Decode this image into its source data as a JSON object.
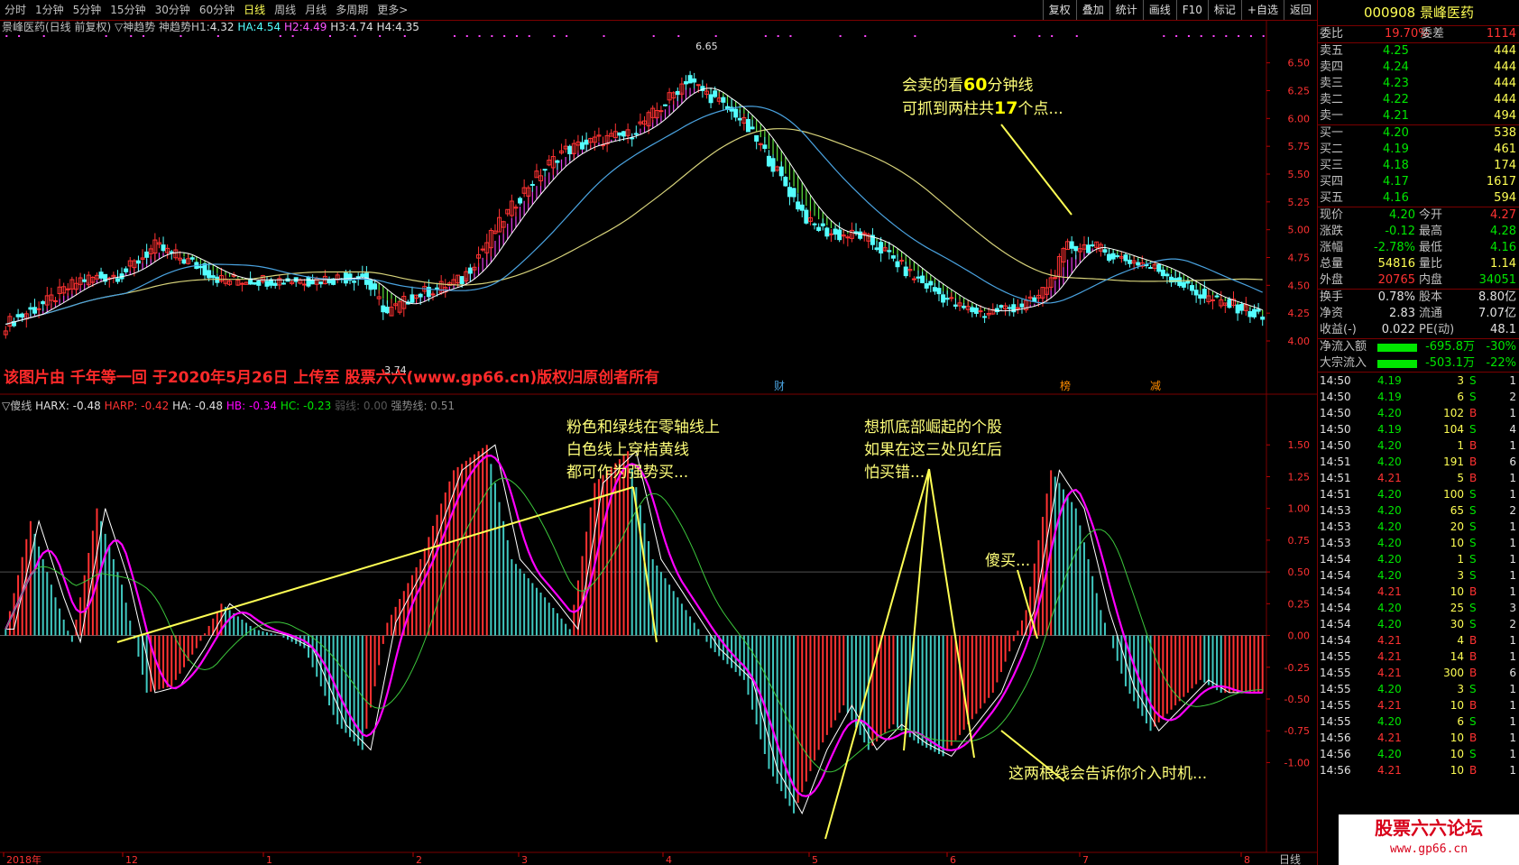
{
  "toolbar": {
    "tabs": [
      "分时",
      "1分钟",
      "5分钟",
      "15分钟",
      "30分钟",
      "60分钟",
      "日线",
      "周线",
      "月线",
      "多周期",
      "更多>"
    ],
    "active_tab": "日线",
    "right_buttons": [
      "复权",
      "叠加",
      "统计",
      "画线",
      "F10",
      "标记",
      "+自选",
      "返回"
    ]
  },
  "chart_header": {
    "stock": "景峰医药(日线 前复权)",
    "indicator": "▽神趋势  神趋势H1:",
    "h1": "4.32",
    "ha_label": "HA:",
    "ha": "4.54",
    "h2_label": "H2:",
    "h2": "4.49",
    "h3_label": "H3:",
    "h3": "4.74",
    "h4_label": "H4:",
    "h4": "4.35"
  },
  "price_axis": [
    "6.50",
    "6.25",
    "6.00",
    "5.75",
    "5.50",
    "5.25",
    "5.00",
    "4.75",
    "4.50",
    "4.25",
    "4.00"
  ],
  "price_annotations": {
    "high": "6.65",
    "low": "3.74"
  },
  "watermark": "该图片由  千年等一回  于2020年5月26日  上传至  股票六六(www.gp66.cn)版权归原创者所有",
  "event_marks": [
    "财",
    "榜",
    "减"
  ],
  "osc_header": {
    "name": "▽傻线",
    "harx": "HARX: -0.48",
    "harp": "HARP: -0.42",
    "ha": "HA: -0.48",
    "hb": "HB: -0.34",
    "hc": "HC: -0.23",
    "hd": "弱线: 0.00",
    "strong": "强势线: 0.51"
  },
  "osc_axis": [
    "1.50",
    "1.25",
    "1.00",
    "0.75",
    "0.50",
    "0.25",
    "0.00",
    "-0.25",
    "-0.50",
    "-0.75",
    "-1.00"
  ],
  "date_axis": {
    "labels": [
      "2018年",
      "12",
      "1",
      "2",
      "3",
      "4",
      "5",
      "6",
      "7",
      "8"
    ],
    "period": "日线"
  },
  "annotations": {
    "top": [
      "会卖的看",
      "60",
      "分钟线",
      "可抓到两柱共",
      "17",
      "个点..."
    ],
    "mid1": [
      "粉色和绿线在零轴线上",
      "白色线上穿桔黄线",
      "都可作为强势买..."
    ],
    "mid2": [
      "想抓底部崛起的个股",
      "如果在这三处见红后",
      "怕买错..."
    ],
    "buy": "傻买...",
    "bottom": "这两根线会告诉你介入时机..."
  },
  "quote": {
    "code": "000908",
    "name": "景峰医药",
    "weibi_label": "委比",
    "weibi": "19.70%",
    "weicha_label": "委差",
    "weicha": "1114",
    "asks": [
      {
        "label": "卖五",
        "price": "4.25",
        "vol": "444"
      },
      {
        "label": "卖四",
        "price": "4.24",
        "vol": "444"
      },
      {
        "label": "卖三",
        "price": "4.23",
        "vol": "444"
      },
      {
        "label": "卖二",
        "price": "4.22",
        "vol": "444"
      },
      {
        "label": "卖一",
        "price": "4.21",
        "vol": "494"
      }
    ],
    "bids": [
      {
        "label": "买一",
        "price": "4.20",
        "vol": "538"
      },
      {
        "label": "买二",
        "price": "4.19",
        "vol": "461"
      },
      {
        "label": "买三",
        "price": "4.18",
        "vol": "174"
      },
      {
        "label": "买四",
        "price": "4.17",
        "vol": "1617"
      },
      {
        "label": "买五",
        "price": "4.16",
        "vol": "594"
      }
    ],
    "stats": [
      [
        "现价",
        "4.20",
        "今开",
        "4.27"
      ],
      [
        "涨跌",
        "-0.12",
        "最高",
        "4.28"
      ],
      [
        "涨幅",
        "-2.78%",
        "最低",
        "4.16"
      ],
      [
        "总量",
        "54816",
        "量比",
        "1.14"
      ],
      [
        "外盘",
        "20765",
        "内盘",
        "34051"
      ]
    ],
    "stats2": [
      [
        "换手",
        "0.78%",
        "股本",
        "8.80亿"
      ],
      [
        "净资",
        "2.83",
        "流通",
        "7.07亿"
      ],
      [
        "收益(-)",
        "0.022",
        "PE(动)",
        "48.1"
      ]
    ],
    "flows": [
      {
        "label": "净流入额",
        "value": "-695.8万",
        "pct": "-30%"
      },
      {
        "label": "大宗流入",
        "value": "-503.1万",
        "pct": "-22%"
      }
    ]
  },
  "ticks": [
    [
      "14:50",
      "4.19",
      "3",
      "S",
      "1"
    ],
    [
      "14:50",
      "4.19",
      "6",
      "S",
      "2"
    ],
    [
      "14:50",
      "4.20",
      "102",
      "B",
      "1"
    ],
    [
      "14:50",
      "4.19",
      "104",
      "S",
      "4"
    ],
    [
      "14:50",
      "4.20",
      "1",
      "B",
      "1"
    ],
    [
      "14:51",
      "4.20",
      "191",
      "B",
      "6"
    ],
    [
      "14:51",
      "4.21",
      "5",
      "B",
      "1"
    ],
    [
      "14:51",
      "4.20",
      "100",
      "S",
      "1"
    ],
    [
      "14:53",
      "4.20",
      "65",
      "S",
      "2"
    ],
    [
      "14:53",
      "4.20",
      "20",
      "S",
      "1"
    ],
    [
      "14:53",
      "4.20",
      "10",
      "S",
      "1"
    ],
    [
      "14:54",
      "4.20",
      "1",
      "S",
      "1"
    ],
    [
      "14:54",
      "4.20",
      "3",
      "S",
      "1"
    ],
    [
      "14:54",
      "4.21",
      "10",
      "B",
      "1"
    ],
    [
      "14:54",
      "4.20",
      "25",
      "S",
      "3"
    ],
    [
      "14:54",
      "4.20",
      "30",
      "S",
      "2"
    ],
    [
      "14:54",
      "4.21",
      "4",
      "B",
      "1"
    ],
    [
      "14:55",
      "4.21",
      "14",
      "B",
      "1"
    ],
    [
      "14:55",
      "4.21",
      "300",
      "B",
      "6"
    ],
    [
      "14:55",
      "4.20",
      "3",
      "S",
      "1"
    ],
    [
      "14:55",
      "4.21",
      "10",
      "B",
      "1"
    ],
    [
      "14:55",
      "4.20",
      "6",
      "S",
      "1"
    ],
    [
      "14:56",
      "4.21",
      "10",
      "B",
      "1"
    ],
    [
      "14:56",
      "4.20",
      "10",
      "S",
      "1"
    ],
    [
      "14:56",
      "4.21",
      "10",
      "B",
      "1"
    ]
  ],
  "logo": {
    "title": "股票六六论坛",
    "url": "www.gp66.cn"
  },
  "colors": {
    "up": "#ff3232",
    "down": "#54ffff",
    "green": "#00e600",
    "yellow": "#ffff54",
    "magenta": "#ff00ff",
    "grid": "#7a0000"
  }
}
